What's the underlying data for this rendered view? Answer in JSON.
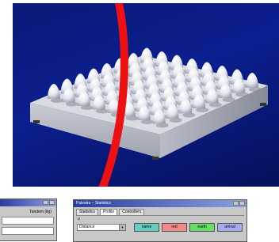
{
  "photo": {
    "subject": "grid of white egg-shaped domes on a grey box platform"
  },
  "window_left": {
    "label": "Tandem (ltg)"
  },
  "window_right": {
    "title": "Palestra – Statistics",
    "tabs": [
      "Statistics",
      "Profile",
      "Controllers"
    ],
    "section_label": "u",
    "select_value": "Distance",
    "swatches": [
      {
        "label": "name",
        "color": "#66ccc0"
      },
      {
        "label": "red",
        "color": "#f28a8a"
      },
      {
        "label": "earth",
        "color": "#66dd66"
      },
      {
        "label": "arrival",
        "color": "#a9a9f0"
      }
    ]
  },
  "colors": {
    "red_stroke": "#ee1111",
    "photo_bg": "#0b1f8f"
  }
}
